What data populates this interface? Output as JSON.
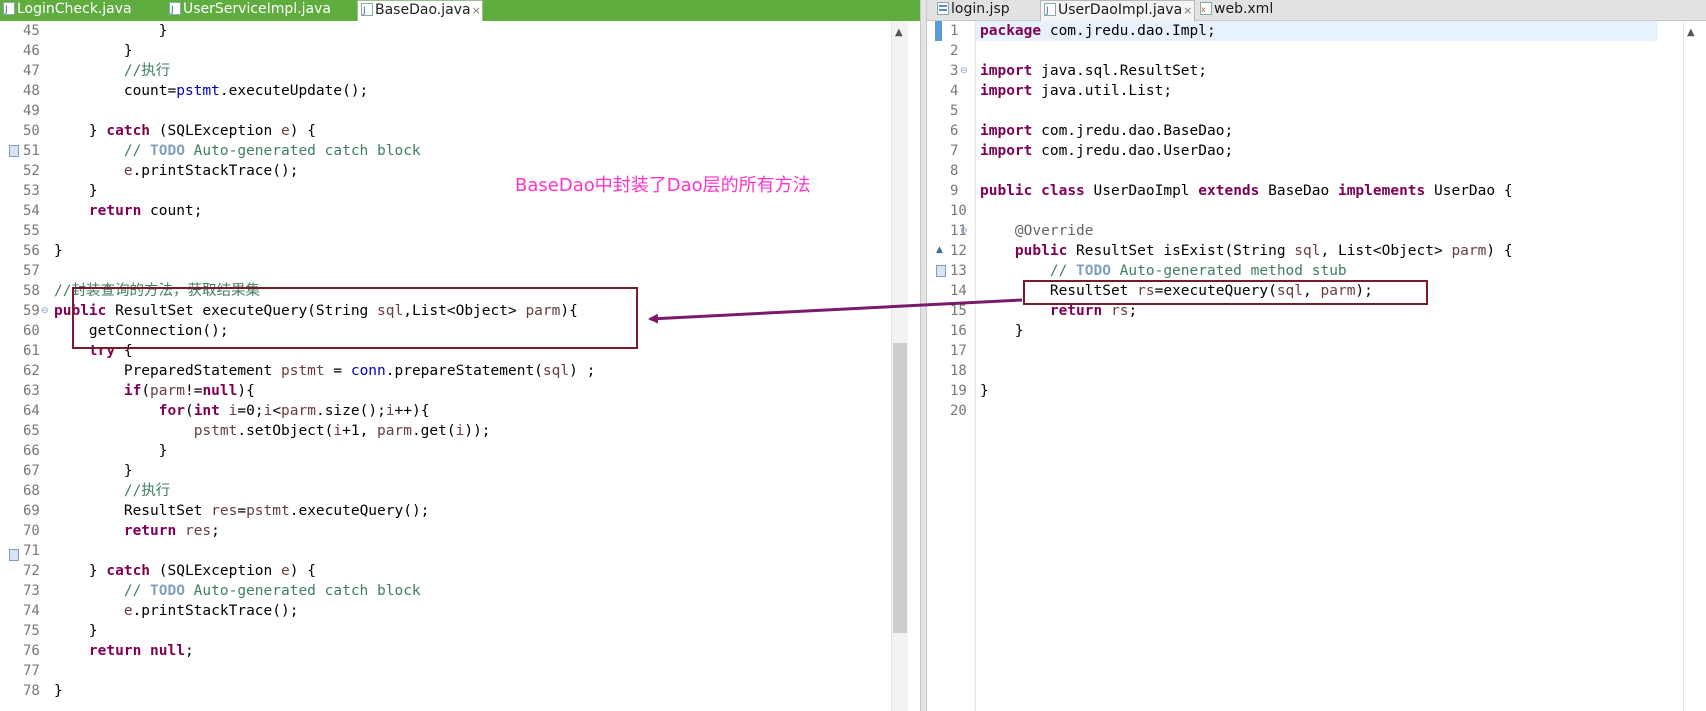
{
  "left_pane": {
    "tabs": [
      {
        "label": "LoginCheck.java",
        "icon": "java-file-icon"
      },
      {
        "label": "UserServiceImpl.java",
        "icon": "java-file-icon"
      },
      {
        "label": "BaseDao.java",
        "icon": "java-file-icon",
        "active": true,
        "close": "×"
      }
    ],
    "line_numbers": [
      "45",
      "46",
      "47",
      "48",
      "49",
      "50",
      "51",
      "52",
      "53",
      "54",
      "55",
      "56",
      "57",
      "58",
      "59",
      "60",
      "61",
      "62",
      "63",
      "64",
      "65",
      "66",
      "67",
      "68",
      "69",
      "70",
      "71",
      "72",
      "73",
      "74",
      "75",
      "76",
      "77",
      "78"
    ],
    "annotation": "BaseDao中封装了Dao层的所有方法"
  },
  "right_pane": {
    "tabs": [
      {
        "label": "login.jsp",
        "icon": "jsp-file-icon"
      },
      {
        "label": "UserDaoImpl.java",
        "icon": "java-file-icon",
        "active": true,
        "close": "×"
      },
      {
        "label": "web.xml",
        "icon": "xml-file-icon"
      }
    ],
    "line_numbers": [
      "1",
      "2",
      "3",
      "4",
      "5",
      "6",
      "7",
      "8",
      "9",
      "10",
      "11",
      "12",
      "13",
      "14",
      "15",
      "16",
      "17",
      "18",
      "19",
      "20"
    ]
  },
  "colors": {
    "keyword": "#7f0055",
    "comment": "#3f7f5f",
    "field": "#0000c0",
    "annotation_text": "#ff33cc",
    "highlight_box": "#7a1a2a",
    "arrow": "#7a1a6a"
  }
}
